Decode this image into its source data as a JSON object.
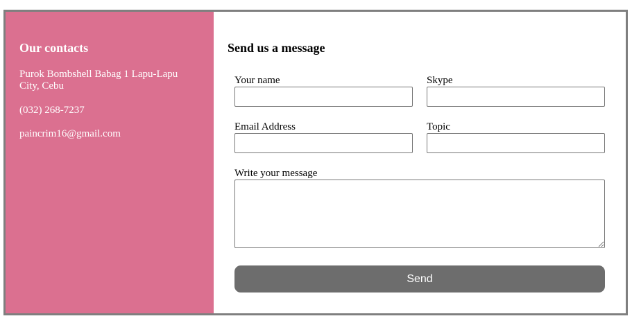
{
  "contacts": {
    "title": "Our contacts",
    "address": "Purok Bombshell Babag 1 Lapu-Lapu City, Cebu",
    "phone": "(032) 268-7237",
    "email": "paincrim16@gmail.com",
    "background_color": "#db7090"
  },
  "form": {
    "title": "Send us a message",
    "name_label": "Your name",
    "name_value": "",
    "skype_label": "Skype",
    "skype_value": "",
    "email_label": "Email Address",
    "email_value": "",
    "topic_label": "Topic",
    "topic_value": "",
    "message_label": "Write your message",
    "message_value": "",
    "send_label": "Send",
    "send_button_color": "#6d6d6d"
  }
}
